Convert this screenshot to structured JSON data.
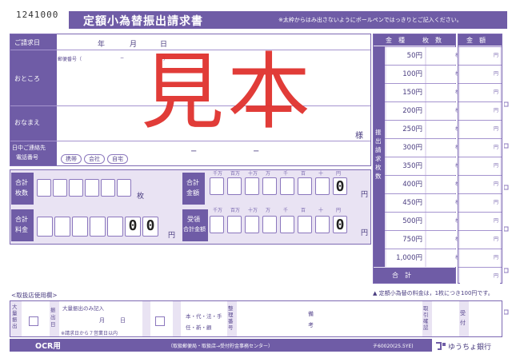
{
  "serial": "1241000",
  "title": "定額小為替振出請求書",
  "notice": "※太枠からはみ出さないようにボールペンではっきりとご記入ください。",
  "date": {
    "label": "ご請求日",
    "year": "年",
    "month": "月",
    "day": "日"
  },
  "address": {
    "label": "おところ",
    "postal_label": "郵便番号（",
    "postal_dash": "−",
    "postal_close": "）"
  },
  "name": {
    "label": "おなまえ",
    "honorific": "様"
  },
  "phone": {
    "label_line1": "日中ご連絡先",
    "label_line2": "電話番号",
    "options": [
      "携帯",
      "会社",
      "自宅"
    ],
    "dash1": "−",
    "dash2": "−"
  },
  "watermark": "見本",
  "totals": {
    "count_label_1": "合計",
    "count_label_2": "枚数",
    "count_unit": "枚",
    "amount_label_1": "合計",
    "amount_label_2": "金額",
    "amount_unit": "円",
    "amount_zero": "0",
    "fee_label_1": "合計",
    "fee_label_2": "料金",
    "fee_zero_1": "0",
    "fee_zero_2": "0",
    "fee_unit": "円",
    "recv_label_1": "受領",
    "recv_label_2": "合計金額",
    "recv_zero": "0",
    "recv_unit": "円",
    "places": [
      "千万",
      "百万",
      "十万",
      "万",
      "千",
      "百",
      "十",
      "円"
    ]
  },
  "denominations": {
    "header_kind": "金　種",
    "header_count": "枚　数",
    "header_amount": "金　額",
    "side_label": "振出請求枚数",
    "count_unit": "枚",
    "amount_unit": "円",
    "rows": [
      "50円",
      "100円",
      "150円",
      "200円",
      "250円",
      "300円",
      "350円",
      "400円",
      "450円",
      "500円",
      "750円",
      "1,000円"
    ],
    "total_label": "合　計"
  },
  "fee_note": "▲ 定額小為替の料金は，1枚につき100円です。",
  "office": {
    "header": "<取扱店使用欄>",
    "big_issue": "大量振出",
    "issue_date_label": "振出日",
    "big_issue_note": "大量振出のみ記入",
    "month": "月",
    "day": "日",
    "within_note": "※請求日から７営業日以内",
    "cell_labels": [
      "本・代・法・手",
      "任・新・顧"
    ],
    "payment_check": "整理番号",
    "remarks": "備考",
    "id_check": "取引確認",
    "receipt": "受付"
  },
  "footer": {
    "ocr": "OCR用",
    "center": "（取扱郵便局・取扱店→受付貯金事務センター）",
    "code": "チ60020(25.5YE)",
    "bank": "ゆうちょ銀行"
  },
  "colors": {
    "accent": "#6f5ca6",
    "light": "#e9e3f3",
    "stamp": "#e0322e"
  }
}
